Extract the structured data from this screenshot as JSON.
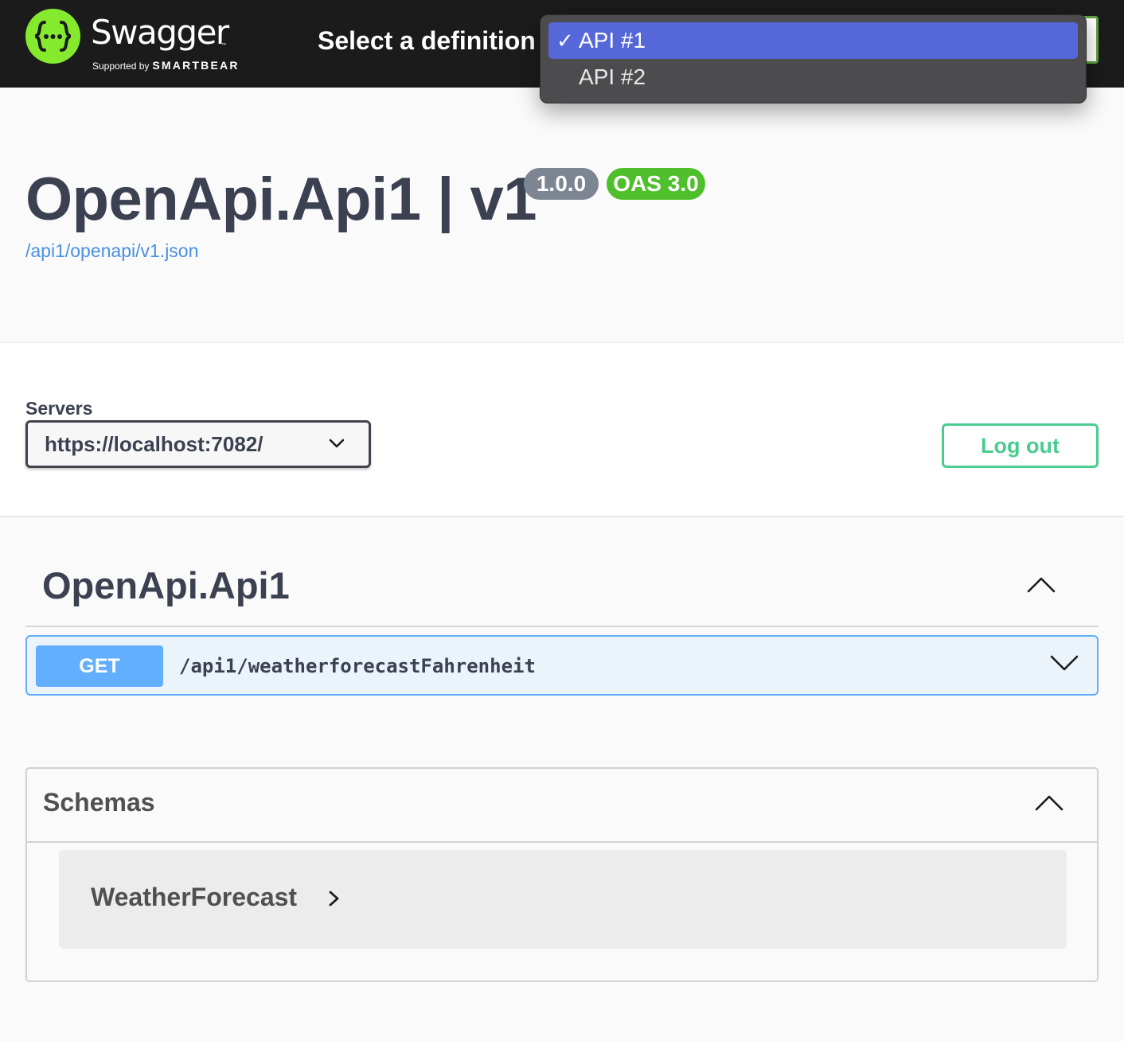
{
  "topbar": {
    "brand": "Swagger",
    "brand_tm": "™",
    "supported_by": "Supported by",
    "smartbear": "SMARTBEAR",
    "select_label": "Select a definition",
    "definitions": [
      {
        "label": "API #1",
        "selected": true,
        "check": "✓"
      },
      {
        "label": "API #2",
        "selected": false
      }
    ]
  },
  "info": {
    "title": "OpenApi.Api1 | v1",
    "version": "1.0.0",
    "oas": "OAS 3.0",
    "spec_url": "/api1/openapi/v1.json"
  },
  "servers": {
    "label": "Servers",
    "selected": "https://localhost:7082/",
    "logout_label": "Log out"
  },
  "tag": {
    "name": "OpenApi.Api1",
    "operations": [
      {
        "method": "GET",
        "path": "/api1/weatherforecastFahrenheit"
      }
    ]
  },
  "schemas": {
    "title": "Schemas",
    "models": [
      {
        "name": "WeatherForecast"
      }
    ]
  },
  "colors": {
    "topbar_bg": "#1b1b1b",
    "logo_green": "#85ea2d",
    "get_blue": "#61affe",
    "logout_green": "#49cc90",
    "dropdown_selected": "#5567d9"
  }
}
